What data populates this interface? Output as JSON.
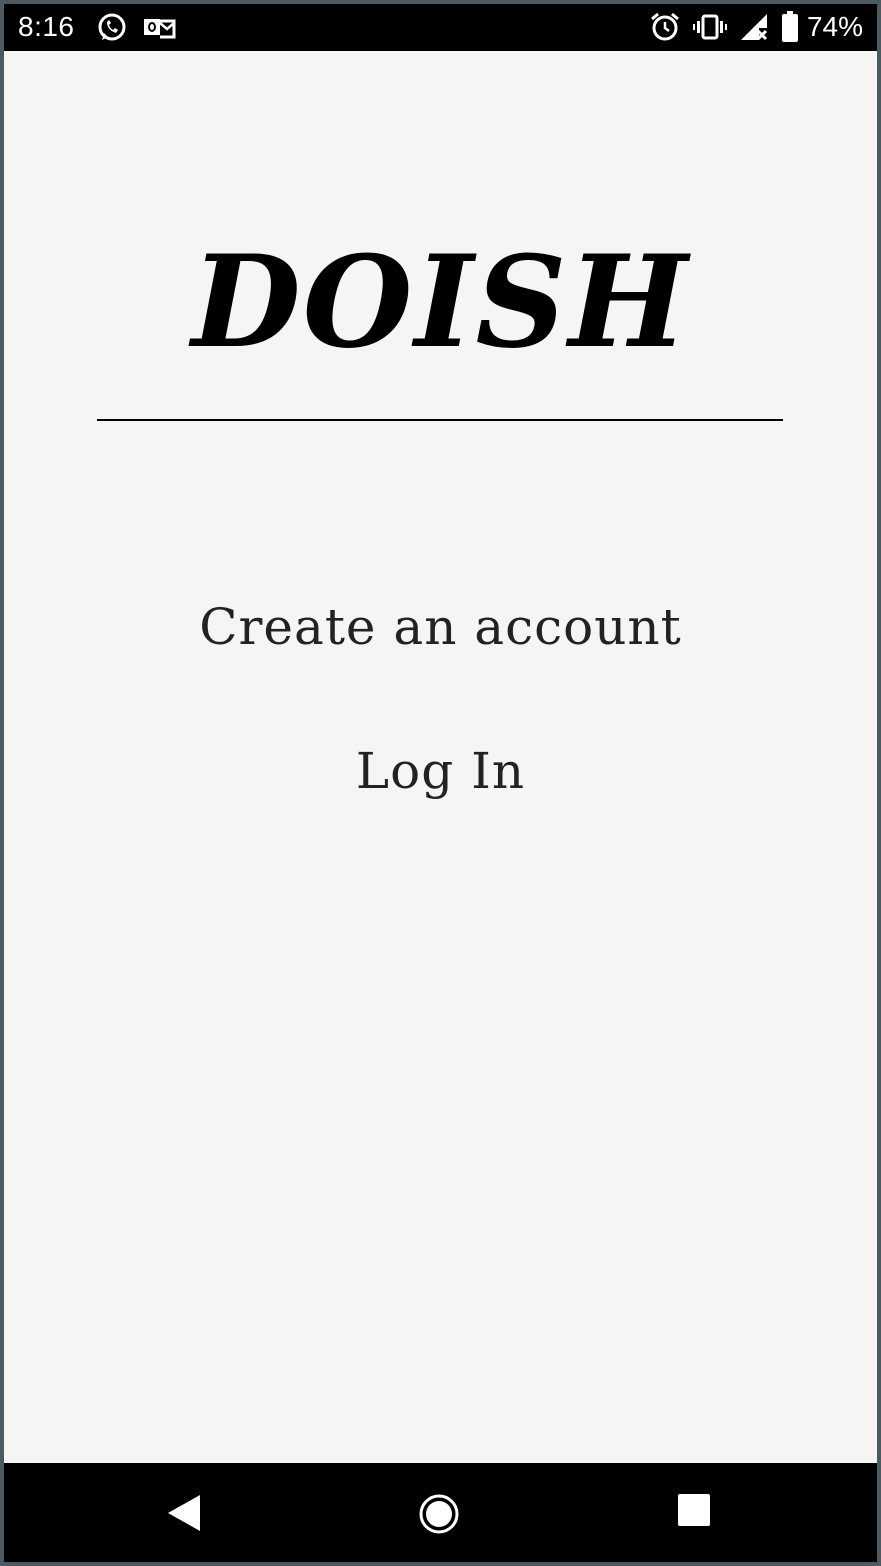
{
  "status_bar": {
    "time": "8:16",
    "battery_percent": "74%",
    "left_icons": [
      "whatsapp-icon",
      "outlook-icon"
    ],
    "right_icons": [
      "alarm-icon",
      "vibrate-icon",
      "signal-icon",
      "battery-icon"
    ]
  },
  "app": {
    "title": "DOISH"
  },
  "menu": {
    "create_account": "Create an account",
    "log_in": "Log In"
  },
  "nav_bar": {
    "buttons": [
      "back-icon",
      "home-icon",
      "recents-icon"
    ]
  },
  "colors": {
    "background": "#f5f5f3",
    "text": "#000000",
    "bars": "#000000"
  }
}
